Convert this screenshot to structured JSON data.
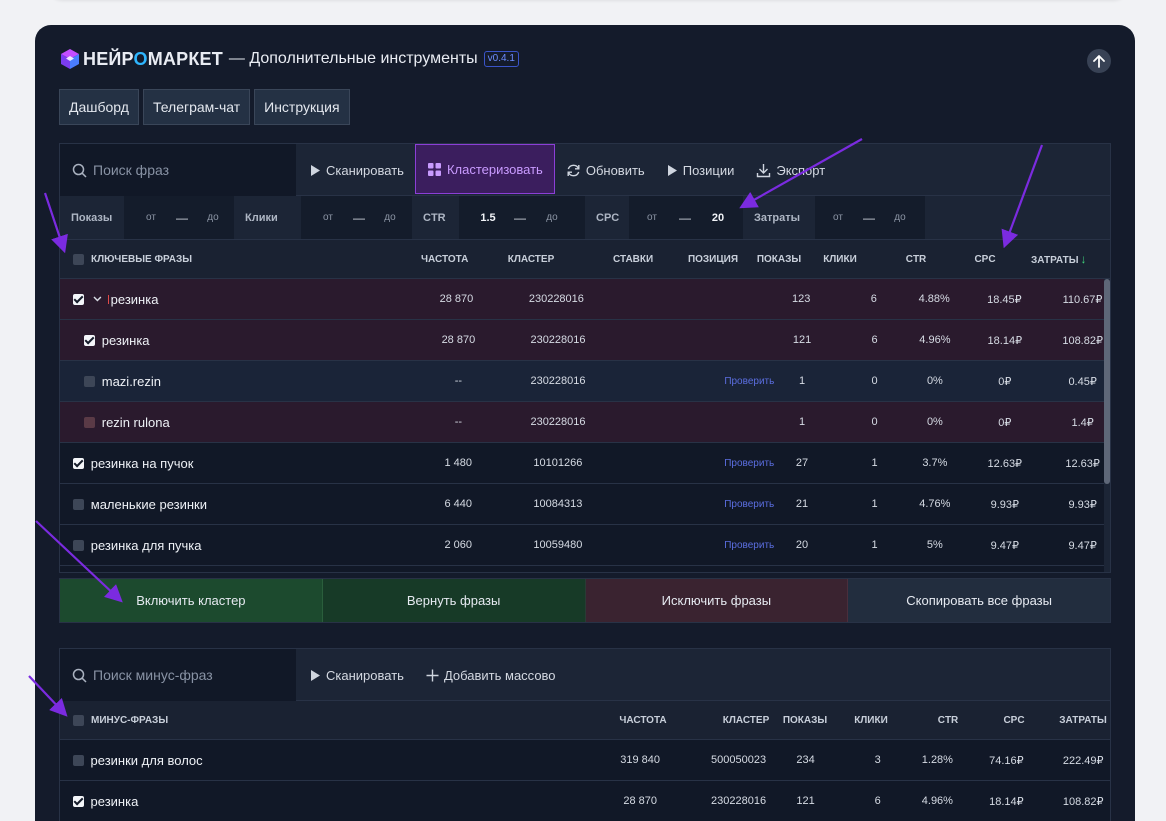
{
  "header": {
    "logo_left": "НЕЙР",
    "logo_o": "О",
    "logo_right": "МАРКЕТ",
    "title": "— Дополнительные инструменты",
    "version": "v0.4.1"
  },
  "tabs": [
    "Дашборд",
    "Телеграм-чат",
    "Инструкция"
  ],
  "toolbar": {
    "search_placeholder": "Поиск фраз",
    "scan": "Сканировать",
    "cluster": "Кластеризовать",
    "refresh": "Обновить",
    "positions": "Позиции",
    "export": "Экспорт"
  },
  "filters": {
    "shows": "Показы",
    "clicks": "Клики",
    "ctr": "CTR",
    "cpc": "CPC",
    "costs": "Затраты",
    "from": "от",
    "to": "до",
    "dash": "—",
    "ctr_from": "1.5",
    "cpc_to": "20"
  },
  "table": {
    "headers": [
      "КЛЮЧЕВЫЕ ФРАЗЫ",
      "ЧАСТОТА",
      "КЛАСТЕР",
      "СТАВКИ",
      "ПОЗИЦИЯ",
      "ПОКАЗЫ",
      "КЛИКИ",
      "CTR",
      "CPC",
      "ЗАТРАТЫ"
    ],
    "sort_arrow": "↓",
    "rows": [
      {
        "kw": "резинка",
        "freq": "28 870",
        "cluster": "230228016",
        "pos": "",
        "shows": "123",
        "clicks": "6",
        "ctr": "4.88%",
        "cpc": "18.45₽",
        "cost": "110.67₽"
      },
      {
        "kw": "резинка",
        "freq": "28 870",
        "cluster": "230228016",
        "pos": "",
        "shows": "121",
        "clicks": "6",
        "ctr": "4.96%",
        "cpc": "18.14₽",
        "cost": "108.82₽"
      },
      {
        "kw": "mazi.rezin",
        "freq": "--",
        "cluster": "230228016",
        "pos": "Проверить",
        "shows": "1",
        "clicks": "0",
        "ctr": "0%",
        "cpc": "0₽",
        "cost": "0.45₽"
      },
      {
        "kw": "rezin rulona",
        "freq": "--",
        "cluster": "230228016",
        "pos": "",
        "shows": "1",
        "clicks": "0",
        "ctr": "0%",
        "cpc": "0₽",
        "cost": "1.4₽"
      },
      {
        "kw": "резинка на пучок",
        "freq": "1 480",
        "cluster": "10101266",
        "pos": "Проверить",
        "shows": "27",
        "clicks": "1",
        "ctr": "3.7%",
        "cpc": "12.63₽",
        "cost": "12.63₽"
      },
      {
        "kw": "маленькие резинки",
        "freq": "6 440",
        "cluster": "10084313",
        "pos": "Проверить",
        "shows": "21",
        "clicks": "1",
        "ctr": "4.76%",
        "cpc": "9.93₽",
        "cost": "9.93₽"
      },
      {
        "kw": "резинка для пучка",
        "freq": "2 060",
        "cluster": "10059480",
        "pos": "Проверить",
        "shows": "20",
        "clicks": "1",
        "ctr": "5%",
        "cpc": "9.47₽",
        "cost": "9.47₽"
      }
    ]
  },
  "actions": [
    "Включить кластер",
    "Вернуть фразы",
    "Исключить фразы",
    "Скопировать все фразы"
  ],
  "minus": {
    "search_placeholder": "Поиск минус-фраз",
    "scan": "Сканировать",
    "add_bulk": "Добавить массово",
    "headers": [
      "МИНУС-ФРАЗЫ",
      "ЧАСТОТА",
      "КЛАСТЕР",
      "ПОКАЗЫ",
      "КЛИКИ",
      "CTR",
      "CPC",
      "ЗАТРАТЫ"
    ],
    "rows": [
      {
        "kw": "резинки для волос",
        "freq": "319 840",
        "cluster": "500050023",
        "shows": "234",
        "clicks": "3",
        "ctr": "1.28%",
        "cpc": "74.16₽",
        "cost": "222.49₽"
      },
      {
        "kw": "резинка",
        "freq": "28 870",
        "cluster": "230228016",
        "shows": "121",
        "clicks": "6",
        "ctr": "4.96%",
        "cpc": "18.14₽",
        "cost": "108.82₽"
      }
    ]
  },
  "colors": {
    "accent": "#8b3fd6",
    "annotation_arrow": "#7b2be0",
    "panel_bg": "#141b2b"
  }
}
